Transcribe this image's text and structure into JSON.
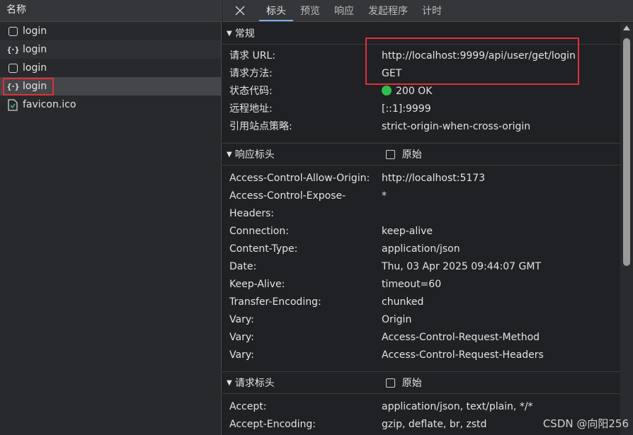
{
  "left": {
    "header": "名称",
    "requests": [
      {
        "name": "login",
        "icon": "document-icon"
      },
      {
        "name": "login",
        "icon": "json-icon"
      },
      {
        "name": "login",
        "icon": "document-icon"
      },
      {
        "name": "login",
        "icon": "json-icon"
      },
      {
        "name": "favicon.ico",
        "icon": "image-file-icon"
      }
    ]
  },
  "tabs": [
    "标头",
    "预览",
    "响应",
    "发起程序",
    "计时"
  ],
  "general": {
    "title": "常规",
    "rows": [
      {
        "k": "请求 URL:",
        "v": "http://localhost:9999/api/user/get/login"
      },
      {
        "k": "请求方法:",
        "v": "GET"
      },
      {
        "k": "状态代码:",
        "v": "200 OK"
      },
      {
        "k": "远程地址:",
        "v": "[::1]:9999"
      },
      {
        "k": "引用站点策略:",
        "v": "strict-origin-when-cross-origin"
      }
    ]
  },
  "response_headers": {
    "title": "响应标头",
    "raw_label": "原始",
    "rows": [
      {
        "k": "Access-Control-Allow-Origin:",
        "v": "http://localhost:5173"
      },
      {
        "k": "Access-Control-Expose-",
        "v": "*"
      },
      {
        "k": "Headers:",
        "v": ""
      },
      {
        "k": "Connection:",
        "v": "keep-alive"
      },
      {
        "k": "Content-Type:",
        "v": "application/json"
      },
      {
        "k": "Date:",
        "v": "Thu, 03 Apr 2025 09:44:07 GMT"
      },
      {
        "k": "Keep-Alive:",
        "v": "timeout=60"
      },
      {
        "k": "Transfer-Encoding:",
        "v": "chunked"
      },
      {
        "k": "Vary:",
        "v": "Origin"
      },
      {
        "k": "Vary:",
        "v": "Access-Control-Request-Method"
      },
      {
        "k": "Vary:",
        "v": "Access-Control-Request-Headers"
      }
    ]
  },
  "request_headers": {
    "title": "请求标头",
    "raw_label": "原始",
    "rows": [
      {
        "k": "Accept:",
        "v": "application/json, text/plain, */*"
      },
      {
        "k": "Accept-Encoding:",
        "v": "gzip, deflate, br, zstd"
      }
    ]
  },
  "watermark": "CSDN @向阳256",
  "colors": {
    "status_ok": "#2fbf50",
    "highlight": "#e0303a",
    "tab_active": "#7cacf8"
  }
}
